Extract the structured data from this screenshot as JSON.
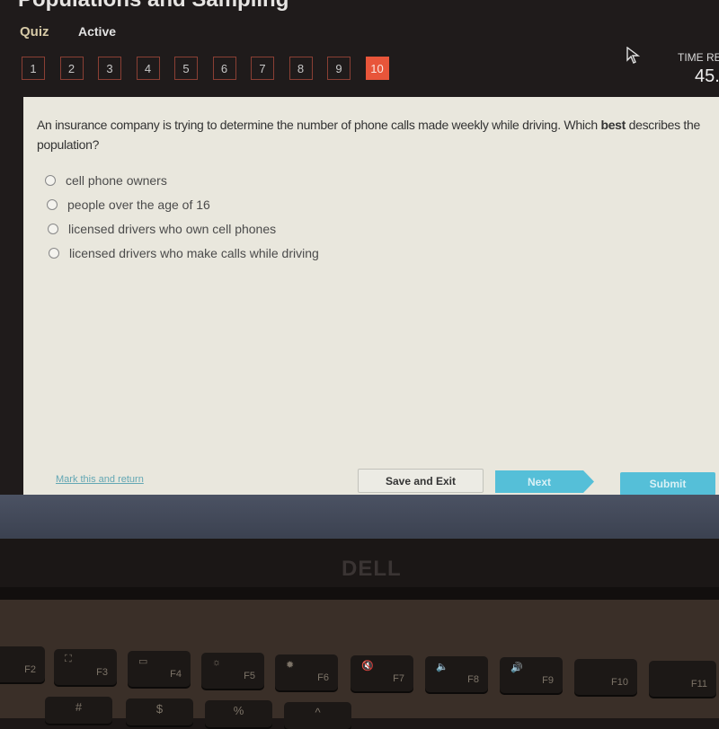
{
  "header": {
    "title": "Populations and Sampling",
    "quiz_label": "Quiz",
    "status": "Active"
  },
  "question_nav": {
    "items": [
      "1",
      "2",
      "3",
      "4",
      "5",
      "6",
      "7",
      "8",
      "9",
      "10"
    ],
    "current": "10",
    "accent": "#e8553a"
  },
  "timer": {
    "label": "TIME RE",
    "value": "45."
  },
  "question": {
    "text_before": "An insurance company is trying to determine the number of phone calls made weekly while driving. Which ",
    "text_bold": "best",
    "text_after": " describes the population?",
    "options": [
      "cell phone owners",
      "people over the age of 16",
      "licensed drivers who own cell phones",
      "licensed drivers who make calls while driving"
    ]
  },
  "footer": {
    "mark_link": "Mark this and return",
    "save_label": "Save and Exit",
    "next_label": "Next",
    "submit_label": "Submit",
    "button_color": "#55bfd8"
  },
  "laptop": {
    "logo": "DELL",
    "fkeys": [
      {
        "label": "F2",
        "icon": "C"
      },
      {
        "label": "F3",
        "icon": "⛶"
      },
      {
        "label": "F4",
        "icon": "▭"
      },
      {
        "label": "F5",
        "icon": "☼"
      },
      {
        "label": "F6",
        "icon": "✹"
      },
      {
        "label": "F7",
        "icon": "🔇"
      },
      {
        "label": "F8",
        "icon": "🔈"
      },
      {
        "label": "F9",
        "icon": "🔊"
      },
      {
        "label": "F10",
        "icon": ""
      },
      {
        "label": "F11",
        "icon": ""
      }
    ],
    "num_keys": [
      "#",
      "$",
      "%",
      "^"
    ]
  }
}
